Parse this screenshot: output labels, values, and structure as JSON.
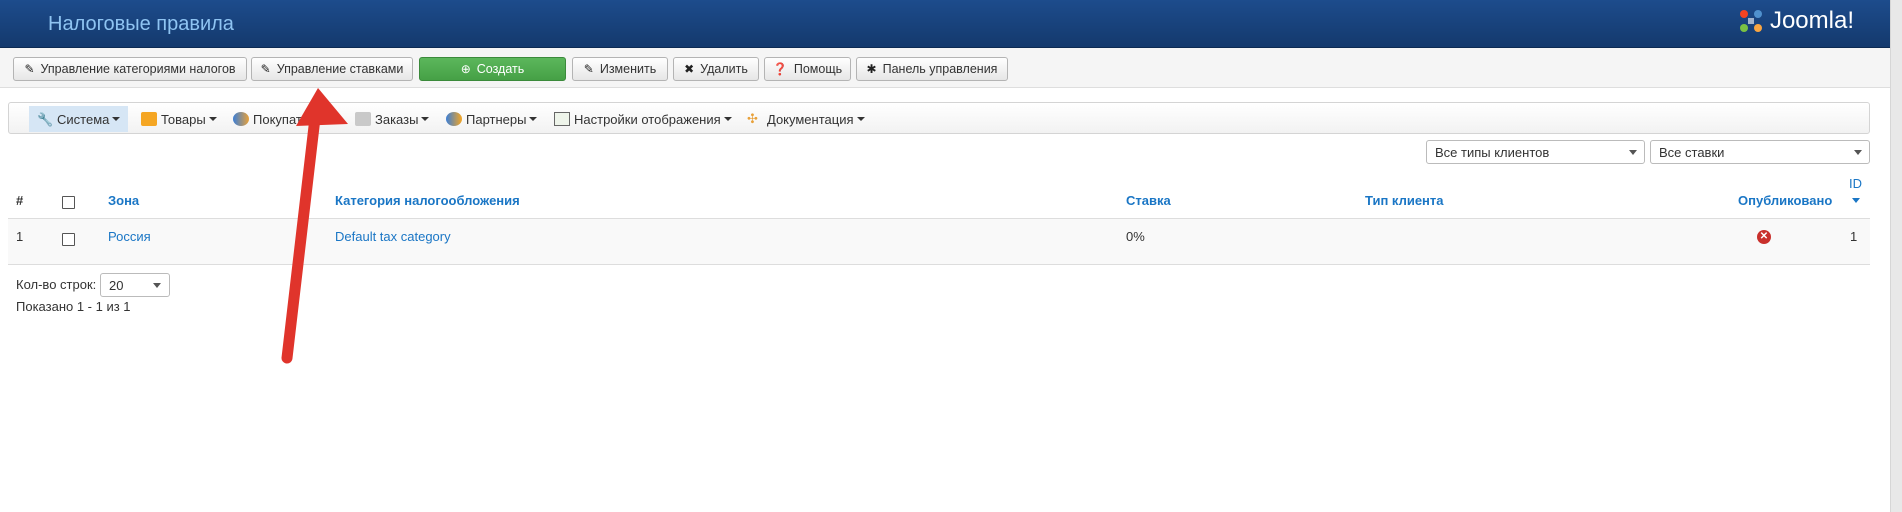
{
  "header": {
    "title": "Налоговые правила",
    "logo_text": "Joomla!"
  },
  "toolbar": {
    "tax_categories": "Управление категориями налогов",
    "manage_rates": "Управление ставками",
    "create": "Создать",
    "edit": "Изменить",
    "delete": "Удалить",
    "help": "Помощь",
    "control_panel": "Панель управления"
  },
  "menu": {
    "system": "Система",
    "products": "Товары",
    "customers": "Покупатели",
    "orders": "Заказы",
    "partners": "Партнеры",
    "display": "Настройки отображения",
    "docs": "Документация"
  },
  "filters": {
    "client_types": "Все типы клиентов",
    "rates": "Все ставки"
  },
  "table": {
    "headers": {
      "num": "#",
      "zone": "Зона",
      "tax_category": "Категория налогообложения",
      "rate": "Ставка",
      "client_type": "Тип клиента",
      "published": "Опубликовано",
      "id": "ID"
    },
    "rows": [
      {
        "num": "1",
        "zone": "Россия",
        "tax_category": "Default tax category",
        "rate": "0%",
        "client_type": "",
        "published": false,
        "id": "1"
      }
    ]
  },
  "footer": {
    "rows_label": "Кол-во строк:",
    "rows_value": "20",
    "shown": "Показано 1 - 1 из 1"
  },
  "colors": {
    "header_bg": "#1d4c8c",
    "link": "#1a76c5",
    "create_btn": "#5cb75c",
    "arrow": "#e0342b"
  }
}
